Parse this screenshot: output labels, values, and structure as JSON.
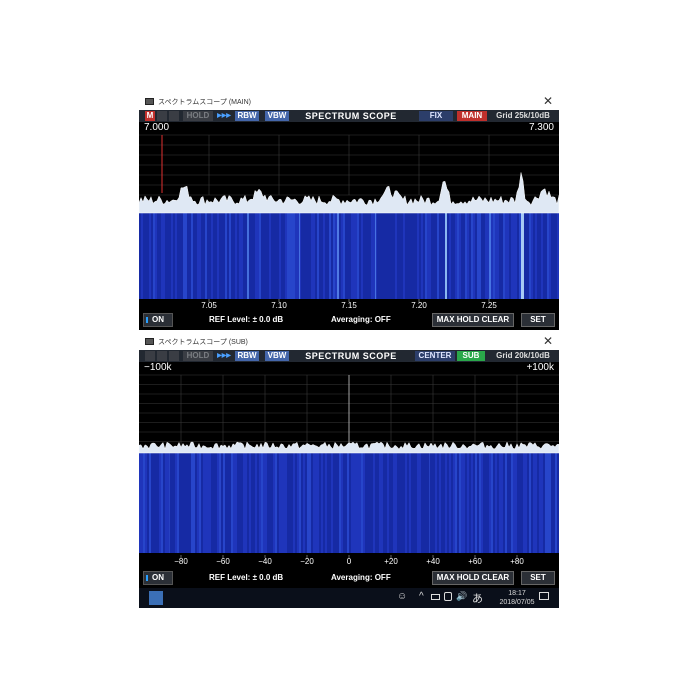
{
  "main_window": {
    "title": "スペクトラムスコープ (MAIN)",
    "toolbar": {
      "m": "M",
      "btn2": "",
      "btn3": "",
      "hold": "HOLD",
      "arrows": "▶▶▶",
      "rbw": "RBW",
      "vbw": "VBW",
      "title": "SPECTRUM SCOPE",
      "mode": "FIX",
      "receiver": "MAIN",
      "grid": "Grid 25k/10dB"
    },
    "range_left": "7.000",
    "range_right": "7.300",
    "ticks": [
      "7.05",
      "7.10",
      "7.15",
      "7.20",
      "7.25"
    ],
    "status": {
      "on": "ON",
      "ref": "REF Level: ± 0.0 dB",
      "avg": "Averaging: OFF",
      "maxhold": "MAX HOLD CLEAR",
      "set": "SET"
    }
  },
  "sub_window": {
    "title": "スペクトラムスコープ (SUB)",
    "toolbar": {
      "m": "",
      "btn2": "",
      "btn3": "",
      "hold": "HOLD",
      "arrows": "▶▶▶",
      "rbw": "RBW",
      "vbw": "VBW",
      "title": "SPECTRUM SCOPE",
      "mode": "CENTER",
      "receiver": "SUB",
      "grid": "Grid 20k/10dB"
    },
    "range_left": "−100k",
    "range_right": "+100k",
    "ticks": [
      "−80",
      "−60",
      "−40",
      "−20",
      "0",
      "+20",
      "+40",
      "+60",
      "+80"
    ],
    "status": {
      "on": "ON",
      "ref": "REF Level: ± 0.0 dB",
      "avg": "Averaging: OFF",
      "maxhold": "MAX HOLD CLEAR",
      "set": "SET"
    }
  },
  "taskbar": {
    "person_icon": "person-icon",
    "caret": "^",
    "volume": "🔊",
    "ime": "あ",
    "time": "18:17",
    "date": "2018/07/05"
  },
  "colors": {
    "spectrum_fill": "#dfe8f4",
    "waterfall_base": "#1a2fae",
    "marker_red": "#e03030"
  }
}
